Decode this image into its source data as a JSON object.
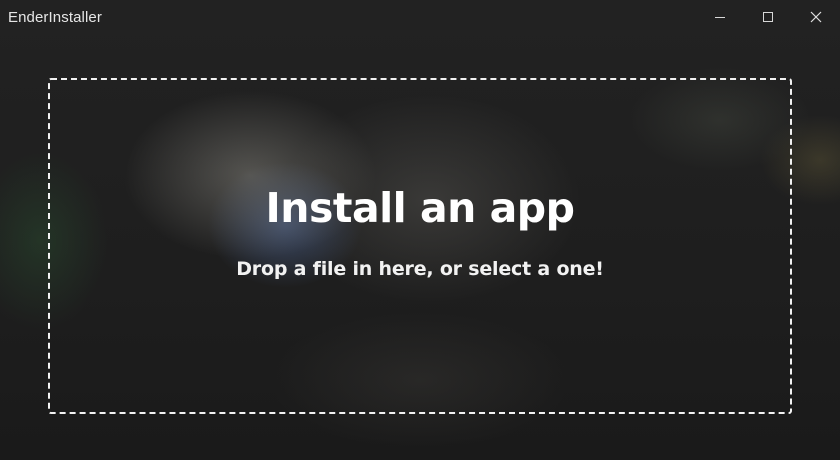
{
  "window": {
    "title": "EnderInstaller",
    "controls": [
      {
        "name": "minimize",
        "icon": "minimize-icon"
      },
      {
        "name": "maximize",
        "icon": "maximize-icon"
      },
      {
        "name": "close",
        "icon": "close-icon"
      }
    ]
  },
  "dropzone": {
    "heading": "Install an app",
    "subtitle": "Drop a file in here, or select a one!"
  },
  "colors": {
    "background": "#1d1d1d",
    "text": "#ffffff",
    "dropzone_border": "#f2f2f2"
  }
}
